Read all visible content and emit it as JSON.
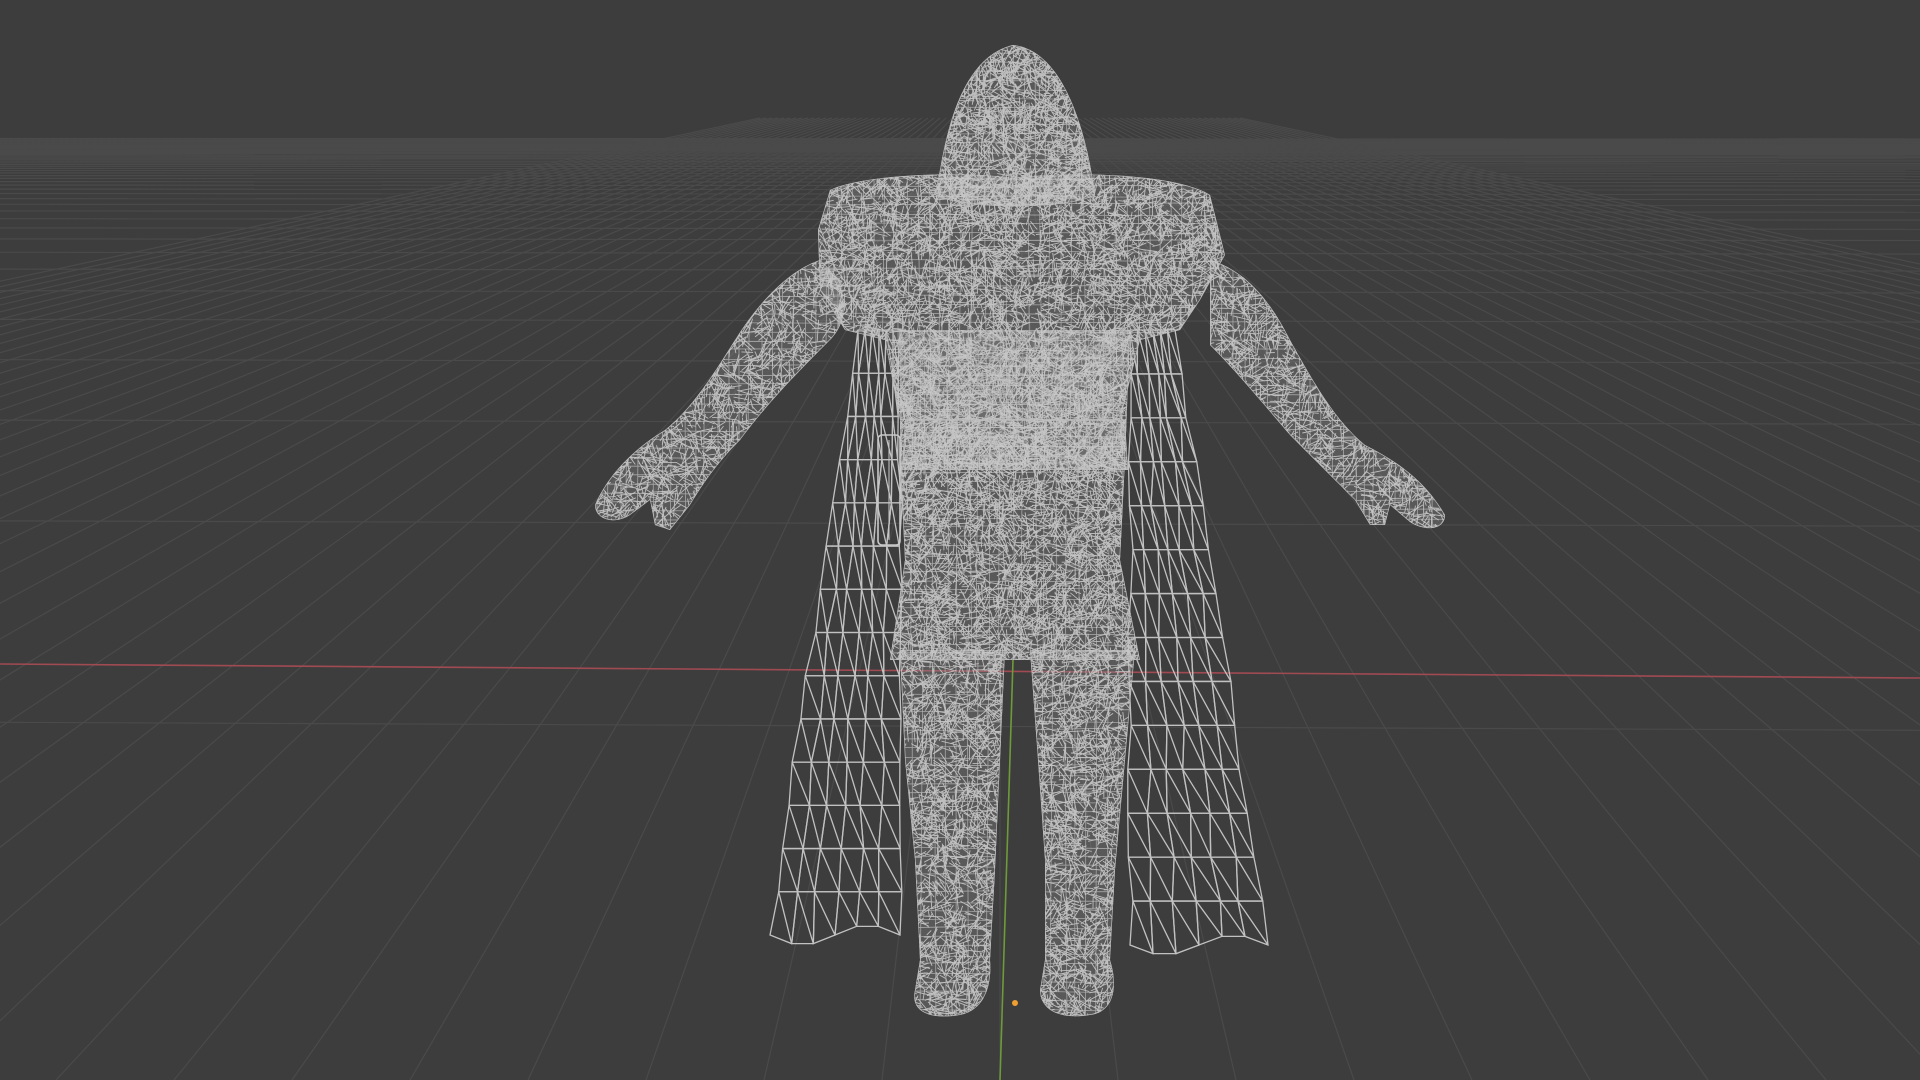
{
  "viewport": {
    "background": "#3d3d3d",
    "grid_color": "#4a4a4a",
    "axis_x_color": "#a04a52",
    "axis_y_color": "#6f9a3a",
    "wire_color": "#c9c9c9",
    "origin_color": "#f0a030"
  },
  "scene": {
    "object": "wireframe-character",
    "display_mode": "wireframe"
  }
}
